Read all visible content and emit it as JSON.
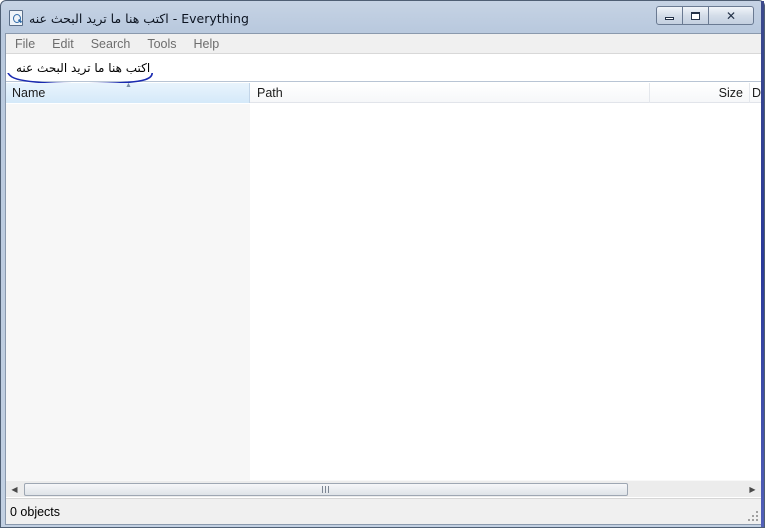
{
  "window": {
    "title": "اكتب هنا ما تريد البحث عنه - Everything",
    "icon": "everything-app-icon",
    "controls": {
      "minimize": "minimize-icon",
      "maximize": "maximize-icon",
      "close": "close-icon"
    }
  },
  "menu": {
    "items": [
      {
        "label": "File"
      },
      {
        "label": "Edit"
      },
      {
        "label": "Search"
      },
      {
        "label": "Tools"
      },
      {
        "label": "Help"
      }
    ]
  },
  "search": {
    "value": "اكتب هنا ما تريد البحث عنه",
    "annotation_color": "#1a2ab0"
  },
  "columns": {
    "name": "Name",
    "path": "Path",
    "size": "Size",
    "date": "D"
  },
  "results": [],
  "status": {
    "text": "0 objects"
  },
  "colors": {
    "frame": "#c2d0e2",
    "header_selected": "#d5e9f9",
    "menu_text": "#6d6d6d",
    "statusbar": "#f0f0f0"
  }
}
